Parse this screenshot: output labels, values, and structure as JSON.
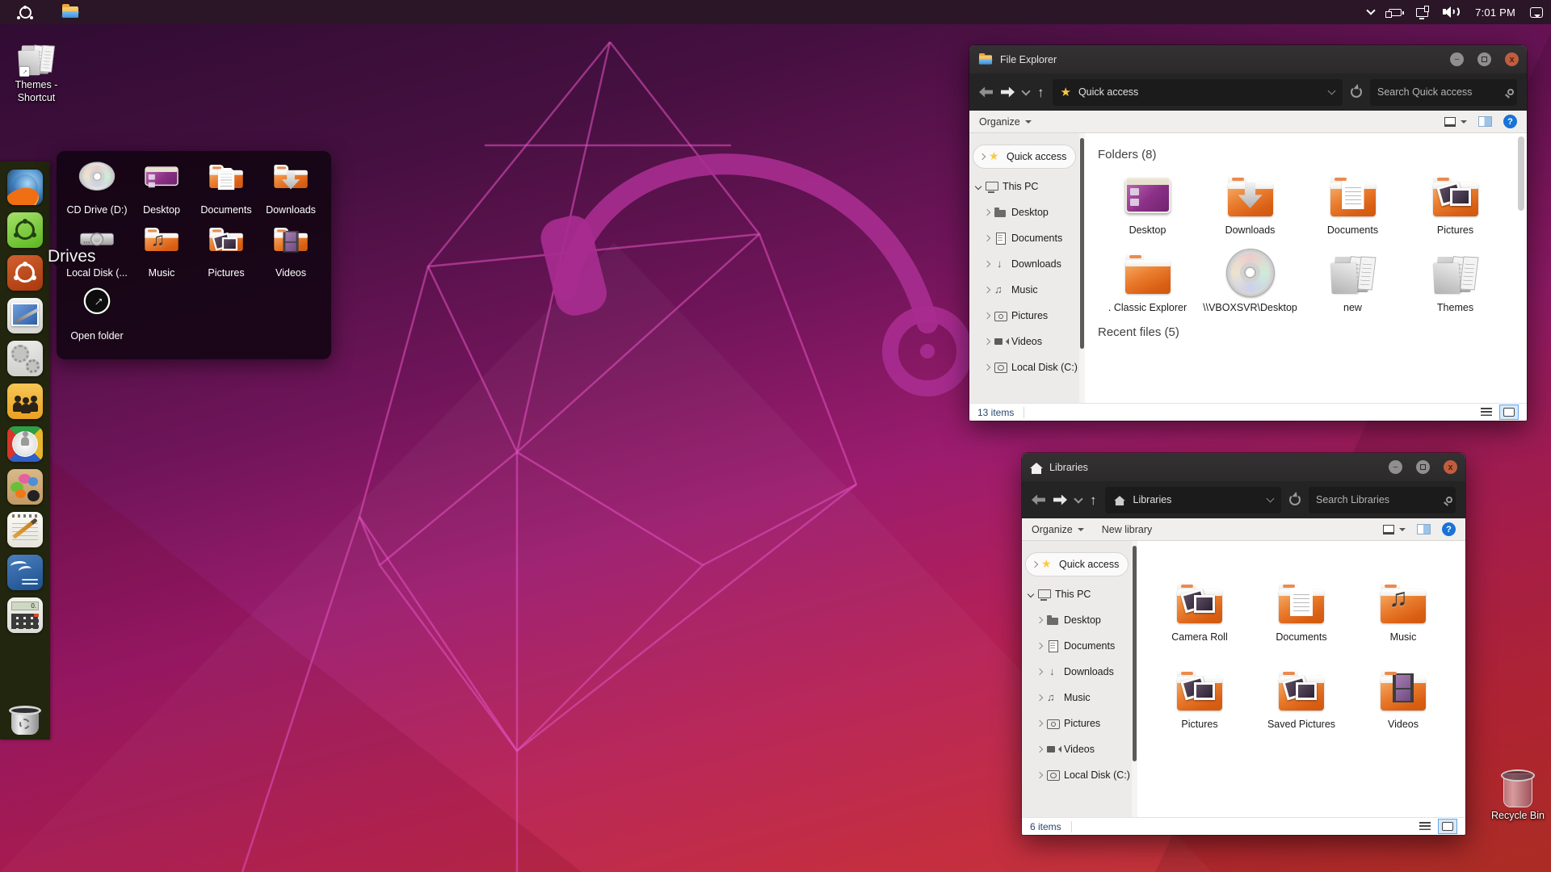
{
  "taskbar": {
    "clock": "7:01 PM"
  },
  "desktop_icons": {
    "themes_shortcut_label": "Themes - Shortcut",
    "recycle_bin_label": "Recycle Bin"
  },
  "dock": {
    "tooltip": "Drives",
    "items": [
      {
        "name": "firefox",
        "icon": "firefox-icon"
      },
      {
        "name": "software-center",
        "icon": "software-center-icon"
      },
      {
        "name": "drives",
        "icon": "drives-icon"
      },
      {
        "name": "display-settings",
        "icon": "display-settings-icon"
      },
      {
        "name": "system-settings",
        "icon": "gears-icon"
      },
      {
        "name": "users",
        "icon": "users-icon"
      },
      {
        "name": "search-tool",
        "icon": "search-tool-icon"
      },
      {
        "name": "graphics",
        "icon": "paint-icon"
      },
      {
        "name": "text-editor",
        "icon": "notepad-icon"
      },
      {
        "name": "writer",
        "icon": "writer-icon"
      },
      {
        "name": "calculator",
        "icon": "calculator-icon"
      },
      {
        "name": "trash",
        "icon": "trash-icon"
      }
    ]
  },
  "drives_flyout": {
    "items": [
      {
        "label": "CD Drive (D:)",
        "icon": "disc"
      },
      {
        "label": "Desktop",
        "icon": "desktop-screen"
      },
      {
        "label": "Documents",
        "icon": "folder-documents"
      },
      {
        "label": "Downloads",
        "icon": "folder-downloads"
      },
      {
        "label": "Local Disk (...",
        "icon": "harddisk"
      },
      {
        "label": "Music",
        "icon": "folder-music"
      },
      {
        "label": "Pictures",
        "icon": "folder-pictures"
      },
      {
        "label": "Videos",
        "icon": "folder-videos"
      },
      {
        "label": "Open folder",
        "icon": "open-folder"
      }
    ]
  },
  "sidebar": {
    "items": [
      {
        "label": "Quick access",
        "icon": "star",
        "chevron": "right",
        "pill": true,
        "indent": 0
      },
      {
        "label": "This PC",
        "icon": "monitor",
        "chevron": "down",
        "pill": false,
        "indent": 0
      },
      {
        "label": "Desktop",
        "icon": "folder",
        "chevron": "right",
        "pill": false,
        "indent": 1
      },
      {
        "label": "Documents",
        "icon": "document",
        "chevron": "right",
        "pill": false,
        "indent": 1
      },
      {
        "label": "Downloads",
        "icon": "download",
        "chevron": "right",
        "pill": false,
        "indent": 1
      },
      {
        "label": "Music",
        "icon": "music",
        "chevron": "right",
        "pill": false,
        "indent": 1
      },
      {
        "label": "Pictures",
        "icon": "camera",
        "chevron": "right",
        "pill": false,
        "indent": 1
      },
      {
        "label": "Videos",
        "icon": "videocam",
        "chevron": "right",
        "pill": false,
        "indent": 1
      },
      {
        "label": "Local Disk (C:)",
        "icon": "disk",
        "chevron": "right",
        "pill": false,
        "indent": 1
      }
    ]
  },
  "explorer_window": {
    "title": "File Explorer",
    "address": "Quick access",
    "search_placeholder": "Search Quick access",
    "organize": "Organize",
    "sections": [
      {
        "header": "Folders (8)",
        "items": [
          {
            "label": "Desktop",
            "icon": "desktop-screen"
          },
          {
            "label": "Downloads",
            "icon": "folder-downloads"
          },
          {
            "label": "Documents",
            "icon": "folder-documents"
          },
          {
            "label": "Pictures",
            "icon": "folder-pictures"
          },
          {
            "label": ". Classic Explorer",
            "icon": "folder-plain"
          },
          {
            "label": "\\\\VBOXSVR\\Desktop",
            "icon": "disc"
          },
          {
            "label": "new",
            "icon": "folder-gray"
          },
          {
            "label": "Themes",
            "icon": "folder-gray"
          }
        ]
      },
      {
        "header": "Recent files (5)",
        "items": []
      }
    ],
    "status": "13 items"
  },
  "libraries_window": {
    "title": "Libraries",
    "address": "Libraries",
    "search_placeholder": "Search Libraries",
    "organize": "Organize",
    "new_library": "New library",
    "items": [
      {
        "label": "Camera Roll",
        "icon": "folder-pictures"
      },
      {
        "label": "Documents",
        "icon": "folder-documents"
      },
      {
        "label": "Music",
        "icon": "folder-music"
      },
      {
        "label": "Pictures",
        "icon": "folder-pictures"
      },
      {
        "label": "Saved Pictures",
        "icon": "folder-pictures"
      },
      {
        "label": "Videos",
        "icon": "folder-videos"
      }
    ],
    "status": "6 items"
  },
  "colors": {
    "folder_orange": "#e2641f",
    "close_button": "#bf5e3f",
    "help_blue": "#1a73d6",
    "star_gold": "#ffc83d",
    "wallpaper_top": "#2e0b31",
    "wallpaper_bottom": "#bf3228"
  }
}
